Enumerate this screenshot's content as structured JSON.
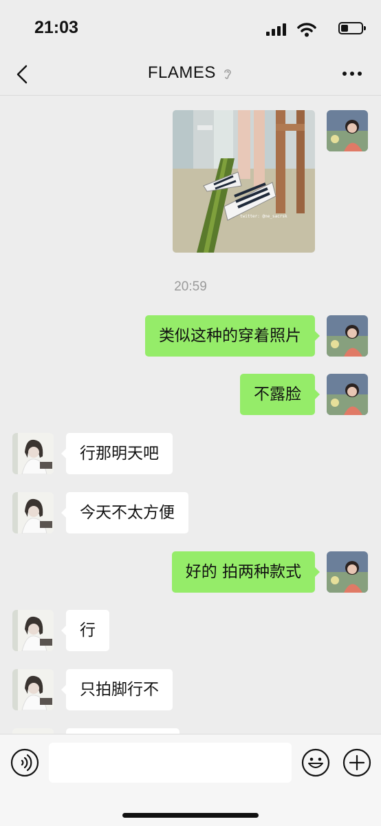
{
  "status_bar": {
    "time": "21:03",
    "battery_level": 0.35
  },
  "nav": {
    "title": "FLAMES",
    "icons": [
      "back-arrow-icon",
      "ear-icon",
      "more-icon"
    ]
  },
  "chat": {
    "photo": {
      "watermark": "twitter: @ne_sacrsk"
    },
    "timestamp": "20:59",
    "messages": [
      {
        "side": "sent",
        "text": "类似这种的穿着照片"
      },
      {
        "side": "sent",
        "text": "不露脸"
      },
      {
        "side": "received",
        "text": "行那明天吧"
      },
      {
        "side": "received",
        "text": "今天不太方便"
      },
      {
        "side": "sent",
        "text": "好的 拍两种款式"
      },
      {
        "side": "received",
        "text": "行"
      },
      {
        "side": "received",
        "text": "只拍脚行不"
      }
    ]
  },
  "input_bar": {
    "message_value": "",
    "icons": [
      "voice-icon",
      "emoji-icon",
      "plus-icon"
    ]
  },
  "colors": {
    "background": "#ededed",
    "sent_bubble": "#95ec69",
    "received_bubble": "#ffffff",
    "timestamp_text": "#9a9a9a"
  }
}
